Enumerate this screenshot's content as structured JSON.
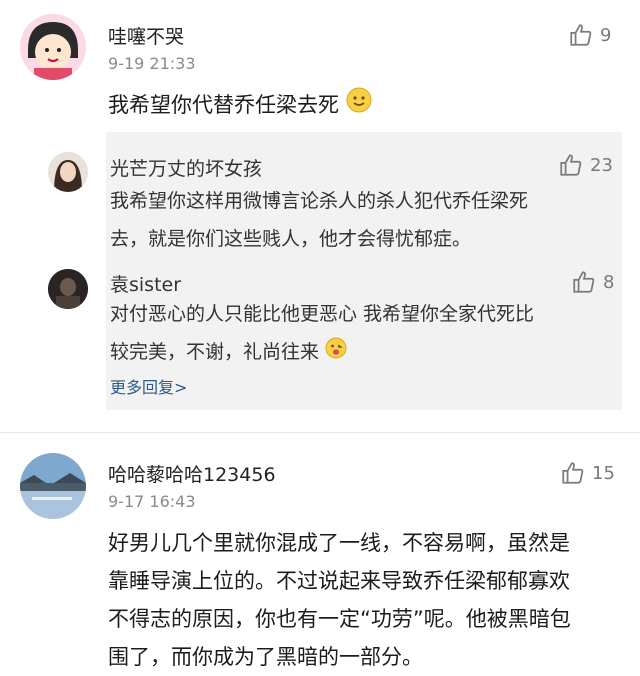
{
  "comments": [
    {
      "user": "哇噻不哭",
      "time": "9-19 21:33",
      "likes": "9",
      "text": "我希望你代替乔任梁去死",
      "replies": [
        {
          "user": "光芒万丈的坏女孩",
          "likes": "23",
          "line1": "我希望你这样用微博言论杀人的杀人犯代乔任梁死",
          "line2": "去，就是你们这些贱人，他才会得忧郁症。"
        },
        {
          "user": "袁sister",
          "likes": "8",
          "line1": "对付恶心的人只能比他更恶心 我希望你全家代死比",
          "line2": "较完美，不谢，礼尚往来"
        }
      ],
      "more_label": "更多回复>"
    },
    {
      "user": "哈哈藜哈哈123456",
      "time": "9-17 16:43",
      "likes": "15",
      "line1": "好男儿几个里就你混成了一线，不容易啊，虽然是",
      "line2": "靠睡导演上位的。不过说起来导致乔任梁郁郁寡欢",
      "line3": "不得志的原因，你也有一定“功劳”呢。他被黑暗包",
      "line4": "围了，而你成为了黑暗的一部分。"
    }
  ],
  "colors": {
    "like_gray": "#7a7a7a",
    "link_blue": "#2c5a8a",
    "reply_bg": "#f2f2f2"
  }
}
